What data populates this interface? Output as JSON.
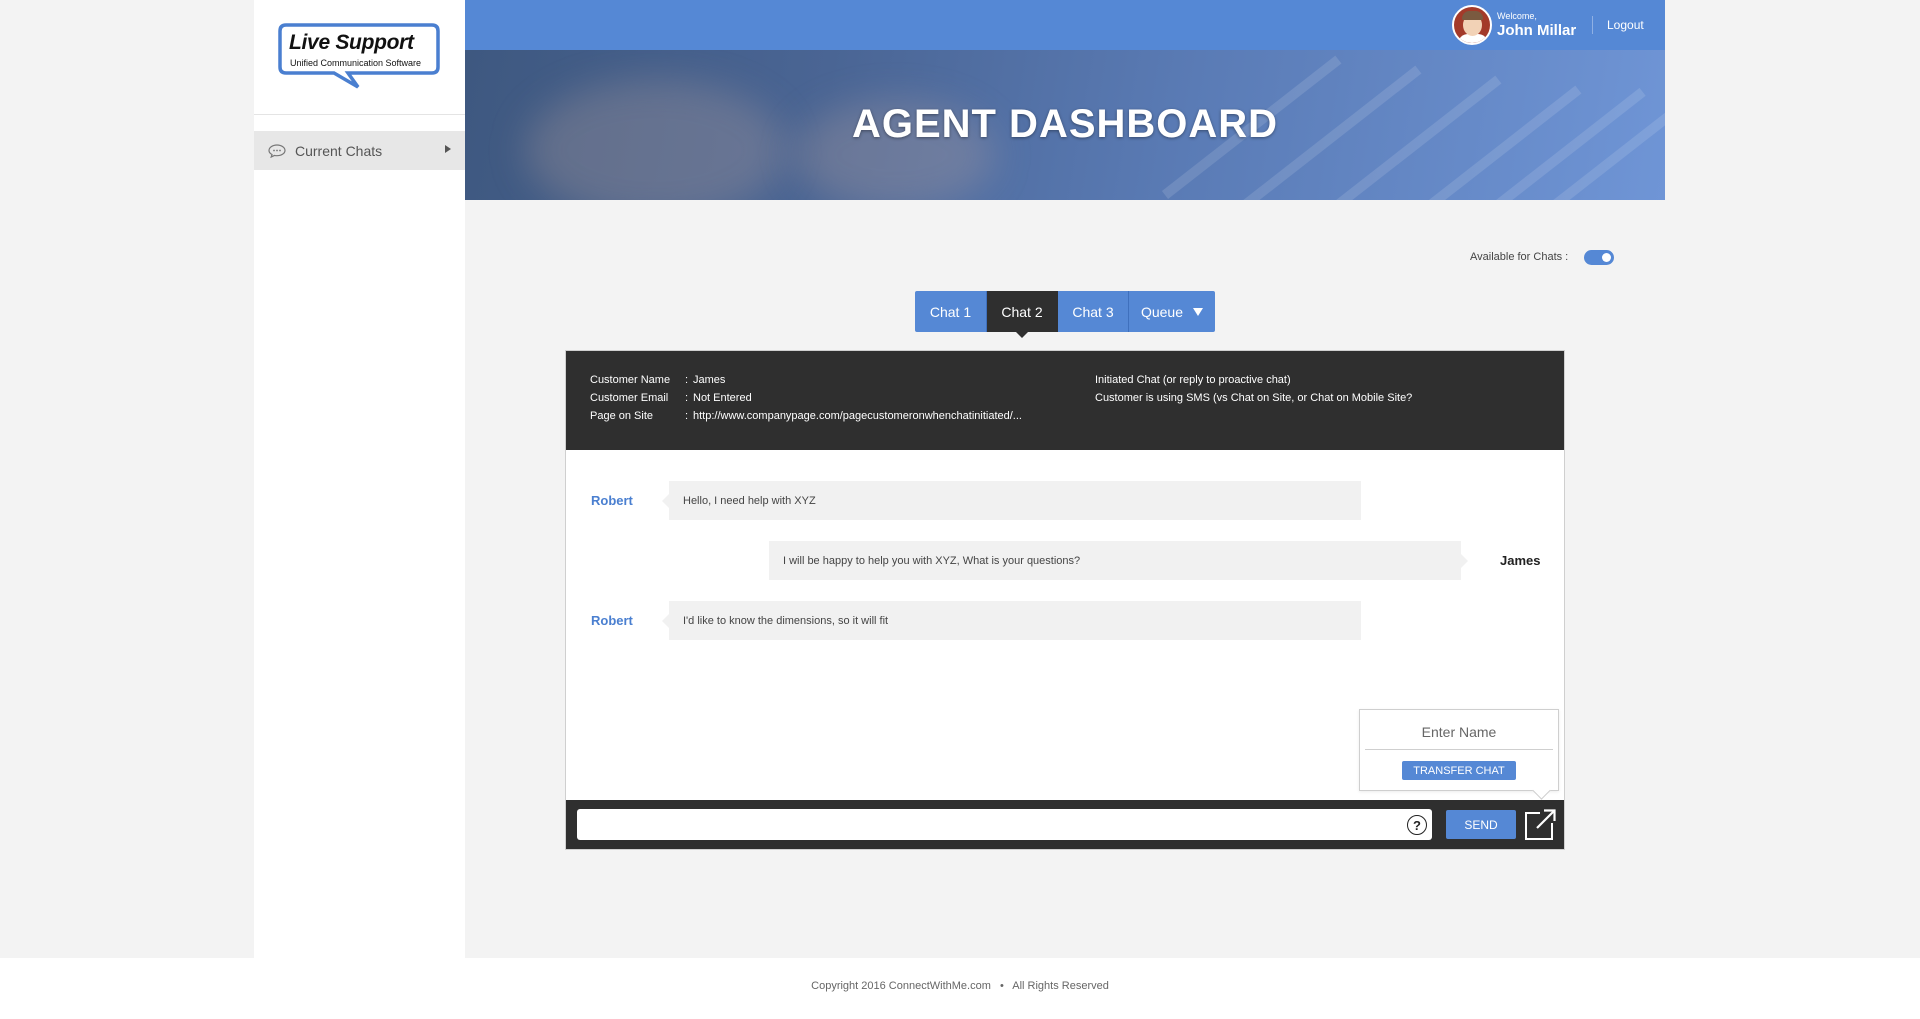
{
  "brand": {
    "logo_title": "Live Support",
    "logo_subtitle": "Unified Communication Software"
  },
  "sidebar": {
    "items": [
      {
        "label": "Current Chats",
        "icon": "chat-bubble-icon"
      }
    ]
  },
  "header": {
    "welcome_label": "Welcome,",
    "user_name": "John Millar",
    "logout_label": "Logout",
    "banner_title": "AGENT DASHBOARD"
  },
  "availability": {
    "label": "Available for Chats :",
    "enabled": true
  },
  "tabs": [
    {
      "label": "Chat 1",
      "active": false
    },
    {
      "label": "Chat 2",
      "active": true
    },
    {
      "label": "Chat 3",
      "active": false
    },
    {
      "label": "Queue",
      "active": false,
      "dropdown": true
    }
  ],
  "customer_info": {
    "rows": [
      {
        "key": "Customer Name",
        "value": "James"
      },
      {
        "key": "Customer Email",
        "value": "Not Entered"
      },
      {
        "key": "Page on Site",
        "value": "http://www.companypage.com/pagecustomeronwhenchatinitiated/..."
      }
    ],
    "notes": [
      "Initiated Chat (or reply to proactive chat)",
      "Customer is using SMS (vs Chat on Site, or Chat on Mobile Site?"
    ]
  },
  "messages": [
    {
      "sender": "Robert",
      "text": "Hello, I need help with XYZ",
      "side": "left"
    },
    {
      "sender": "James",
      "text": "I will be happy to help you with XYZ, What is your questions?",
      "side": "right"
    },
    {
      "sender": "Robert",
      "text": "I'd like to know the dimensions, so it will fit",
      "side": "left"
    }
  ],
  "transfer": {
    "placeholder": "Enter Name",
    "button_label": "TRANSFER CHAT"
  },
  "composer": {
    "value": "",
    "help_label": "?",
    "send_label": "SEND"
  },
  "footer": {
    "copyright": "Copyright 2016 ConnectWithMe.com",
    "separator": "•",
    "rights": "All Rights Reserved"
  },
  "colors": {
    "accent": "#5588d5",
    "dark": "#2f2f2f",
    "page_bg": "#f3f3f3"
  }
}
